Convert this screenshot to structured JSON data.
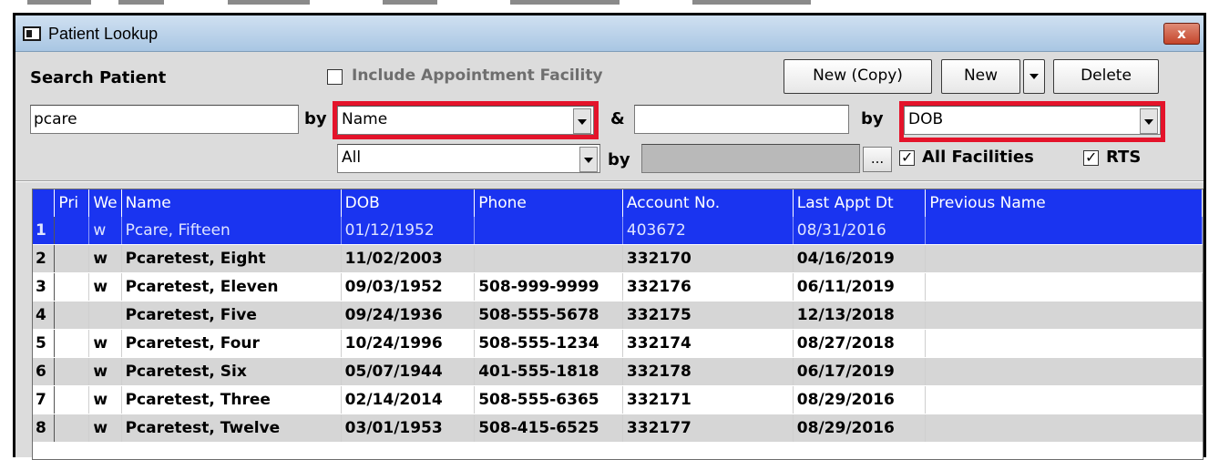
{
  "window": {
    "title": "Patient Lookup",
    "close_label": "x"
  },
  "search": {
    "label": "Search Patient",
    "include_facility_label": "Include Appointment Facility",
    "include_facility_checked": false,
    "primary_value": "pcare",
    "by1_label": "by",
    "by1_value": "Name",
    "and_label": "&",
    "secondary_value": "",
    "by2_label": "by",
    "by2_value": "DOB",
    "filter_value": "All",
    "by3_label": "by",
    "by3_value": "",
    "ellipsis_label": "...",
    "all_facilities_label": "All Facilities",
    "all_facilities_checked": true,
    "rts_label": "RTS",
    "rts_checked": true
  },
  "toolbar": {
    "new_copy_label": "New (Copy)",
    "new_label": "New",
    "delete_label": "Delete"
  },
  "grid": {
    "columns": [
      "",
      "Pri",
      "We",
      "Name",
      "DOB",
      "Phone",
      "Account No.",
      "Last Appt Dt",
      "Previous Name"
    ],
    "selected_row": 1,
    "rows": [
      {
        "n": "1",
        "pri": "",
        "w": "w",
        "name": "Pcare, Fifteen",
        "dob": "01/12/1952",
        "phone": "",
        "account": "403672",
        "last_appt": "08/31/2016",
        "prev": ""
      },
      {
        "n": "2",
        "pri": "",
        "w": "w",
        "name": "Pcaretest, Eight",
        "dob": "11/02/2003",
        "phone": "",
        "account": "332170",
        "last_appt": "04/16/2019",
        "prev": ""
      },
      {
        "n": "3",
        "pri": "",
        "w": "w",
        "name": "Pcaretest, Eleven",
        "dob": "09/03/1952",
        "phone": "508-999-9999",
        "account": "332176",
        "last_appt": "06/11/2019",
        "prev": ""
      },
      {
        "n": "4",
        "pri": "",
        "w": "",
        "name": "Pcaretest, Five",
        "dob": "09/24/1936",
        "phone": "508-555-5678",
        "account": "332175",
        "last_appt": "12/13/2018",
        "prev": ""
      },
      {
        "n": "5",
        "pri": "",
        "w": "w",
        "name": "Pcaretest, Four",
        "dob": "10/24/1996",
        "phone": "508-555-1234",
        "account": "332174",
        "last_appt": "08/27/2018",
        "prev": ""
      },
      {
        "n": "6",
        "pri": "",
        "w": "w",
        "name": "Pcaretest, Six",
        "dob": "05/07/1944",
        "phone": "401-555-1818",
        "account": "332178",
        "last_appt": "06/17/2019",
        "prev": ""
      },
      {
        "n": "7",
        "pri": "",
        "w": "w",
        "name": "Pcaretest, Three",
        "dob": "02/14/2014",
        "phone": "508-555-6365",
        "account": "332171",
        "last_appt": "08/29/2016",
        "prev": ""
      },
      {
        "n": "8",
        "pri": "",
        "w": "w",
        "name": "Pcaretest, Twelve",
        "dob": "03/01/1953",
        "phone": "508-415-6525",
        "account": "332177",
        "last_appt": "08/29/2016",
        "prev": ""
      }
    ]
  },
  "colors": {
    "accent": "#1a34f0",
    "highlight": "#e4132a",
    "window_bg": "#dcdcdc"
  }
}
